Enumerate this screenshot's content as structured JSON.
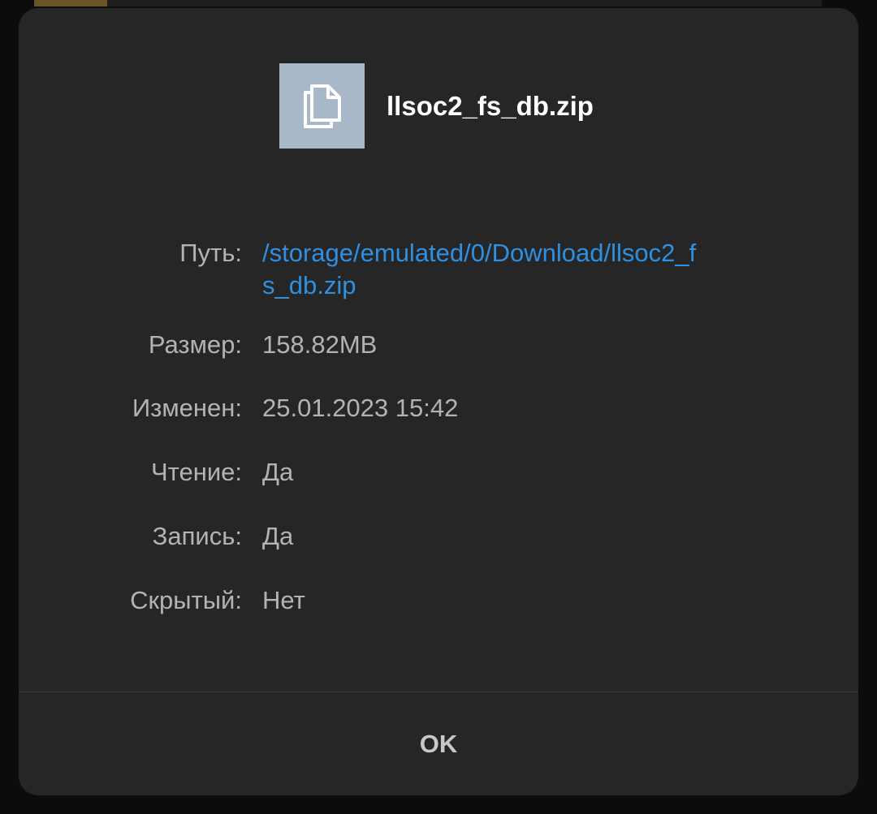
{
  "dialog": {
    "file_icon": "file-copy-icon",
    "file_name": "llsoc2_fs_db.zip",
    "properties": {
      "path": {
        "label": "Путь:",
        "value": "/storage/emulated/0/Download/llsoc2_fs_db.zip"
      },
      "size": {
        "label": "Размер:",
        "value": "158.82MB"
      },
      "modified": {
        "label": "Изменен:",
        "value": "25.01.2023 15:42"
      },
      "read": {
        "label": "Чтение:",
        "value": "Да"
      },
      "write": {
        "label": "Запись:",
        "value": "Да"
      },
      "hidden": {
        "label": "Скрытый:",
        "value": "Нет"
      }
    },
    "ok_label": "OK"
  },
  "colors": {
    "dialog_background": "#262626",
    "link": "#2f8fe0",
    "thumb_background": "#a8b8c8"
  }
}
